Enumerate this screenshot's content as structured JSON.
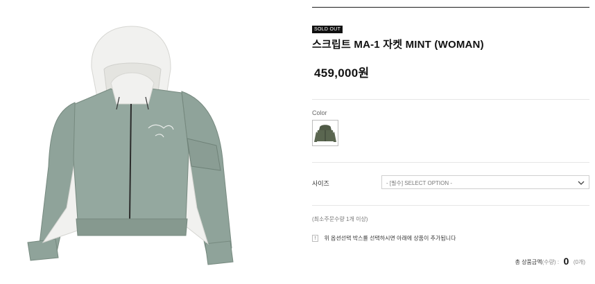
{
  "product": {
    "badge": "SOLD OUT",
    "title": "스크립트 MA-1 자켓 MINT (WOMAN)",
    "price": "459,000원",
    "image_alt": "Mint MA-1 jacket with white hood"
  },
  "options": {
    "color_label": "Color",
    "size_label": "사이즈",
    "size_select": {
      "selected": "- [필수] SELECT OPTION -"
    }
  },
  "notes": {
    "min_order": "(최소주문수량 1개 이상)",
    "notice_icon": "!",
    "notice_text": "위 옵션선택 박스를 선택하시면 아래에 상품이 추가됩니다"
  },
  "total": {
    "label": "총 상품금액",
    "qty_label": "(수량)",
    "separator": " :",
    "value": "0",
    "count": "(0개)"
  },
  "colors": {
    "jacket": "#8fa39a",
    "jacket_dark": "#7a8e85",
    "hood": "#f1f1ef",
    "swatch": "#5a6650"
  },
  "icons": {
    "select_chevron": "chevron-down-icon",
    "notice": "notice-icon"
  }
}
